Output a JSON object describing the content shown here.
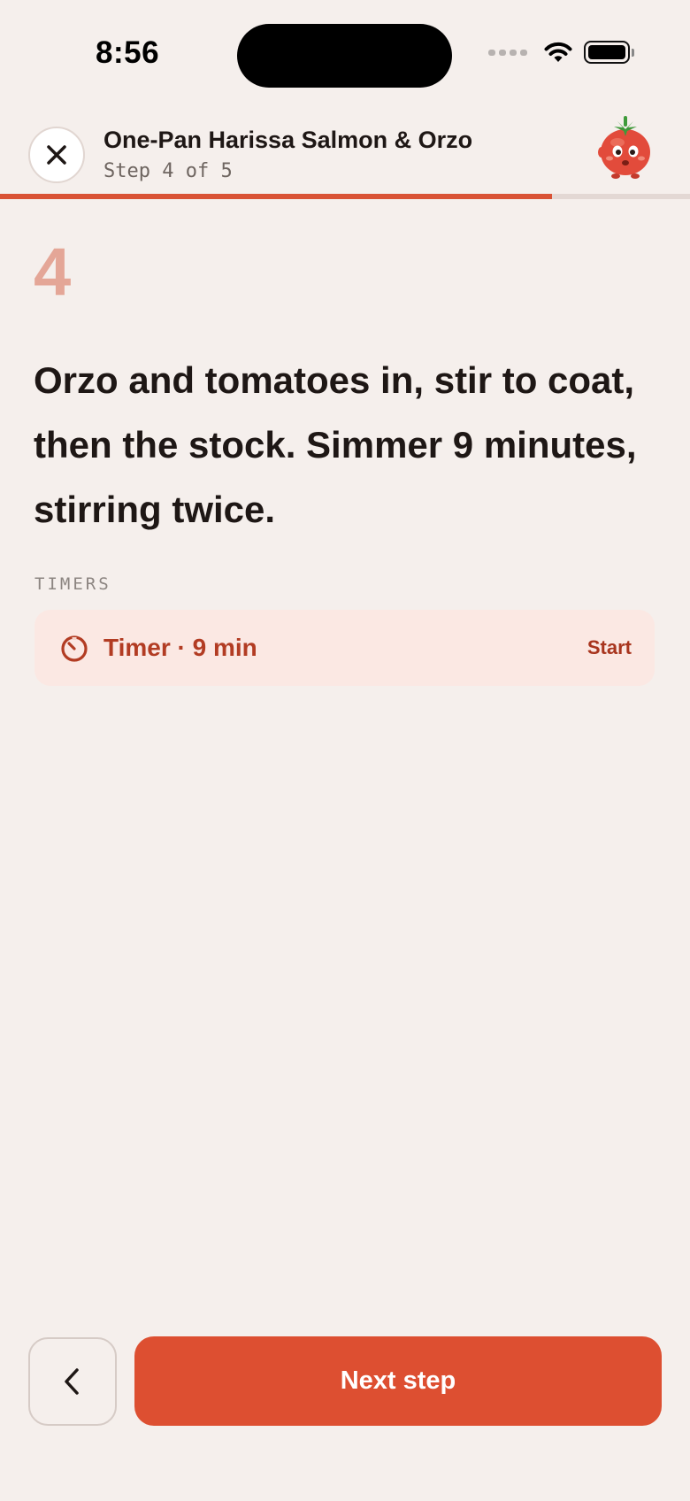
{
  "status_bar": {
    "time": "8:56",
    "icons": [
      "signal-icon",
      "wifi-icon",
      "battery-icon"
    ]
  },
  "header": {
    "close_icon": "close-icon",
    "title": "One-Pan Harissa Salmon & Orzo",
    "step_label": "Step 4 of 5",
    "mascot_icon": "tomato-mascot-icon",
    "progress": {
      "current": 4,
      "total": 5,
      "fraction": 0.8
    }
  },
  "step": {
    "number": "4",
    "instruction": "Orzo and tomatoes in, stir to coat, then the stock. Simmer 9 minutes, stirring twice."
  },
  "timers": {
    "section_label": "TIMERS",
    "items": [
      {
        "icon": "timer-icon",
        "label": "Timer · 9 min",
        "action": "Start"
      }
    ]
  },
  "footer": {
    "back_icon": "chevron-left-icon",
    "next_label": "Next step"
  },
  "colors": {
    "background": "#F5EFEC",
    "accent": "#DD4F31",
    "progress_fill": "#D95235",
    "progress_track": "#E3D8D4",
    "step_number": "#E4A697",
    "timer_card_bg": "#FBE8E3",
    "timer_text": "#B23C23",
    "text_primary": "#1E1715"
  }
}
